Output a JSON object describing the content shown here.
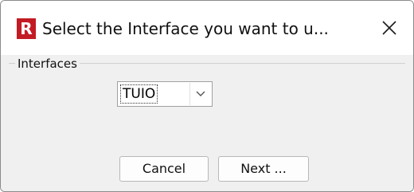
{
  "window": {
    "app_icon_letter": "R",
    "title": "Select the Interface you want to u...",
    "close_icon": "close-icon"
  },
  "group": {
    "label": "Interfaces"
  },
  "interface_select": {
    "selected_value": "TUIO",
    "arrow_icon": "chevron-down-icon"
  },
  "buttons": {
    "cancel_label": "Cancel",
    "next_label": "Next ..."
  },
  "colors": {
    "app_icon_bg": "#c31b24",
    "window_bg": "#f0f0f0",
    "titlebar_bg": "#ffffff"
  }
}
